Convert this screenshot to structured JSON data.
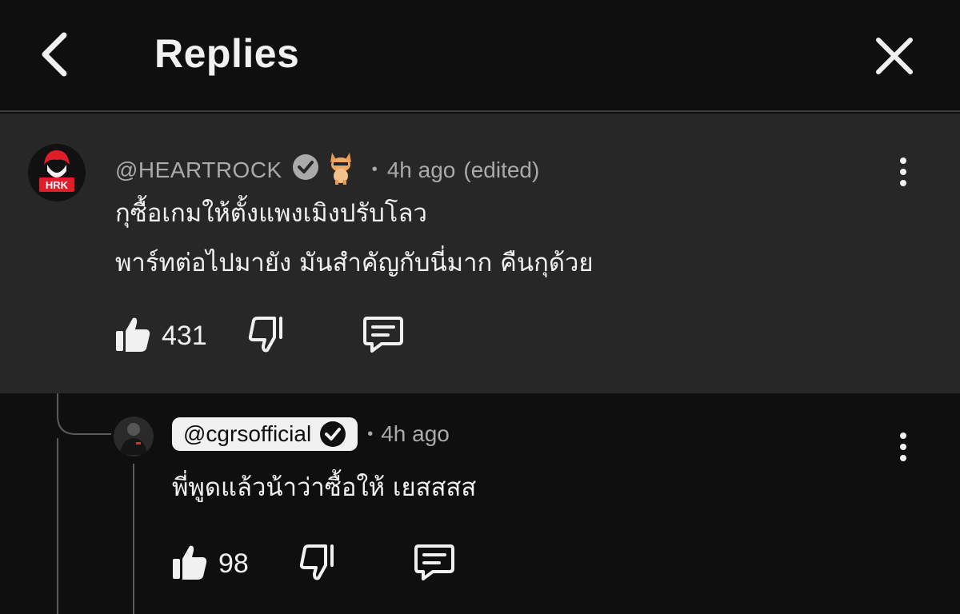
{
  "header": {
    "title": "Replies"
  },
  "parent": {
    "handle": "@HEARTROCK",
    "avatar_text": "HRK",
    "time": "4h ago",
    "edited": "(edited)",
    "line1": "กุซื้อเกมให้ตั้งแพงเมิงปรับโลว",
    "line2": "พาร์ทต่อไปมายัง มันสำคัญกับนี่มาก คืนกุด้วย",
    "likes": "431"
  },
  "reply": {
    "handle": "@cgrsofficial",
    "time": "4h ago",
    "text": "พี่พูดแล้วน้าว่าซื้อให้ เยสสสส",
    "likes": "98"
  },
  "colors": {
    "background": "#0f0f0f",
    "highlight": "#272727",
    "text": "#f1f1f1",
    "secondary": "#aaaaaa",
    "accent_red": "#e11d2a"
  },
  "icons": [
    "back-arrow-icon",
    "close-icon",
    "verified-icon",
    "cat-emoji-icon",
    "more-vert-icon",
    "like-icon",
    "dislike-icon",
    "reply-icon"
  ]
}
